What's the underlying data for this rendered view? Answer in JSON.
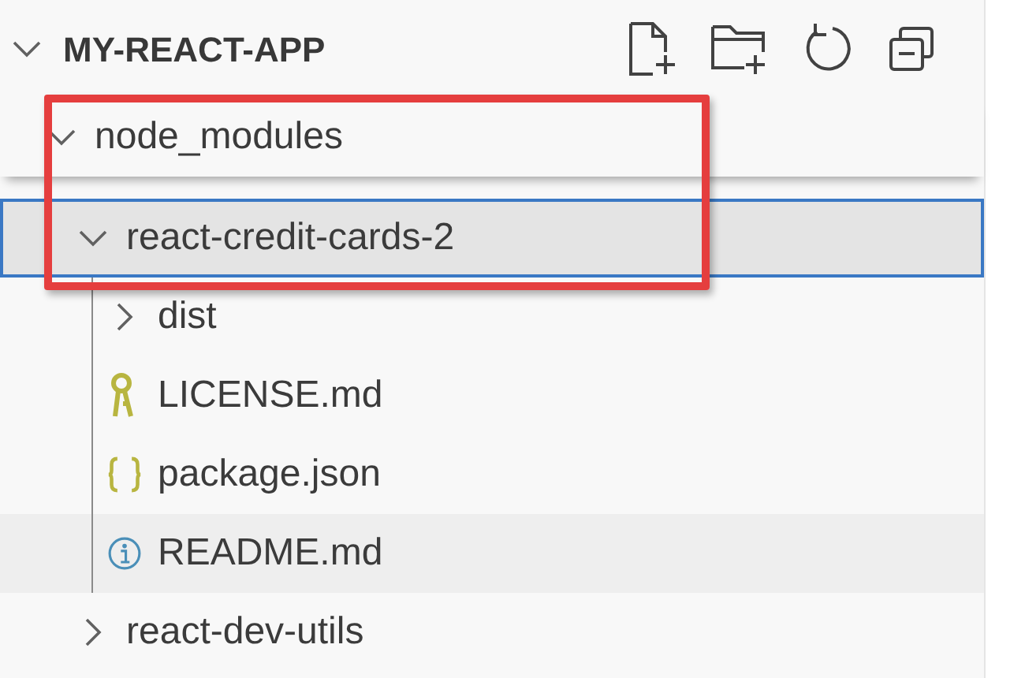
{
  "explorer": {
    "title": "MY-REACT-APP",
    "expanded": true,
    "actions": [
      {
        "kind": "new-file"
      },
      {
        "kind": "new-folder"
      },
      {
        "kind": "refresh"
      },
      {
        "kind": "collapse"
      }
    ],
    "tree": [
      {
        "label": "node_modules",
        "kind": "folder",
        "expanded": true,
        "selected": false,
        "children": [
          {
            "label": "react-credit-cards-2",
            "kind": "folder",
            "expanded": true,
            "selected": true,
            "children": [
              {
                "label": "dist",
                "kind": "folder",
                "expanded": false,
                "selected": false
              },
              {
                "label": "LICENSE.md",
                "kind": "license",
                "selected": false
              },
              {
                "label": "package.json",
                "kind": "json",
                "selected": false
              },
              {
                "label": "README.md",
                "kind": "info",
                "selected": false,
                "hovered": true
              }
            ]
          },
          {
            "label": "react-dev-utils",
            "kind": "folder",
            "expanded": false,
            "selected": false
          }
        ]
      }
    ]
  },
  "highlight_frame": true
}
